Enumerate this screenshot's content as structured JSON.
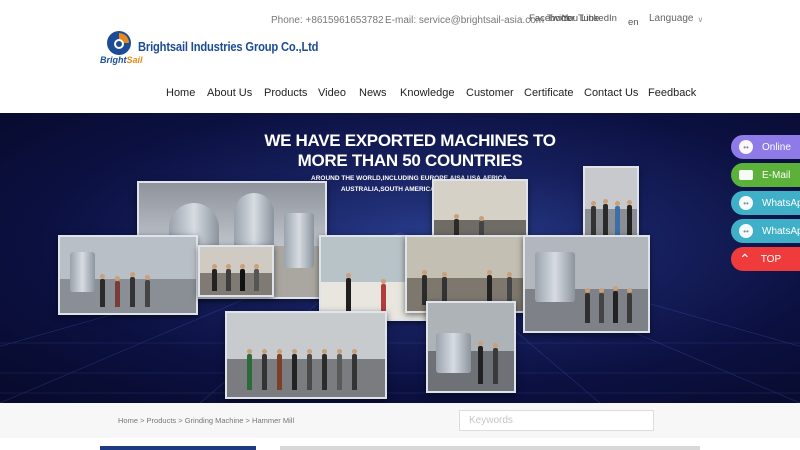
{
  "header": {
    "phone": "Phone: +8615961653782",
    "email": "E-mail: service@brightsail-asia.com",
    "social": [
      "Facebook",
      "Twitter",
      "YouTube",
      "LinkedIn",
      "en"
    ],
    "language": "Language"
  },
  "logo": {
    "short_a": "Bright",
    "short_b": "Sail",
    "company": "Brightsail Industries Group Co.,Ltd"
  },
  "nav": [
    "Home",
    "About Us",
    "Products",
    "Video",
    "News",
    "Knowledge",
    "Customer",
    "Certificate",
    "Contact Us",
    "Feedback"
  ],
  "banner": {
    "headline_1": "WE HAVE EXPORTED MACHINES TO",
    "headline_2": "MORE THAN 50 COUNTRIES",
    "subline_1": "AROUND THE WORLD,INCLUDING EUROPE,AISA,USA,AFRICA,",
    "subline_2": "AUSTRALIA,SOUTH AMERICA AREAS....ETC"
  },
  "float_buttons": [
    {
      "label": "Online",
      "color": "#8e7be8"
    },
    {
      "label": "E-Mail",
      "color": "#5bb13a"
    },
    {
      "label": "WhatsApp",
      "color": "#3fb0c8"
    },
    {
      "label": "WhatsApp",
      "color": "#3fb0c8"
    },
    {
      "label": "TOP",
      "color": "#ef3b3b"
    }
  ],
  "breadcrumb": "Home > Products > Grinding Machine > Hammer Mill",
  "search": {
    "placeholder": "Keywords",
    "value": ""
  },
  "colors": {
    "brand": "#1d4c96",
    "accent": "#e88a1a",
    "banner_bg": "#0b1040"
  }
}
